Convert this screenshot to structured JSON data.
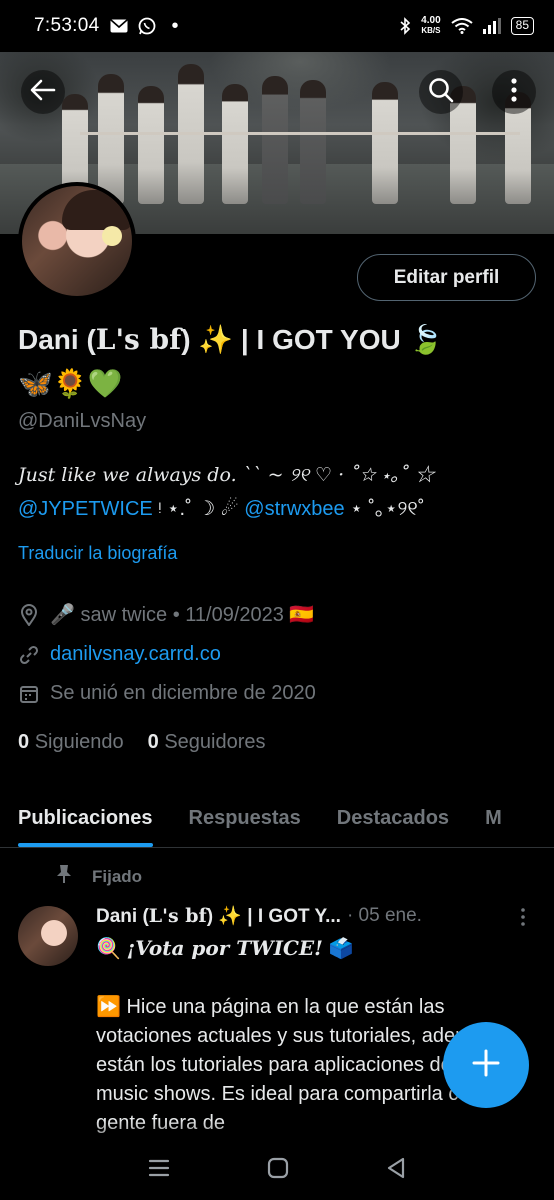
{
  "status_bar": {
    "time": "7:53:04",
    "speed_value": "4.00",
    "speed_unit": "KB/S",
    "battery": "85",
    "dot": "•"
  },
  "header": {
    "back_icon": "arrow-left-icon",
    "search_icon": "search-icon",
    "more_icon": "more-vertical-icon"
  },
  "profile": {
    "edit_button": "Editar perfil",
    "name_part1": "Dani (",
    "name_serif": "L's bf",
    "name_part2": ") ✨ | I GOT YOU 🍃",
    "name_line2": "🦋🌻💚",
    "handle": "@DaniLvsNay",
    "bio_line1": "Just like we always do. `` ~ ୨୧ ♡ · ˚☆ ⋆｡˚ ☆",
    "bio_mention1": "@JYPETWICE",
    "bio_mid": " ᵎ ⋆.˚ ☽ ☄ ",
    "bio_mention2": "@strwxbee",
    "bio_end": " ⋆ ˚｡⋆୨୧˚",
    "translate": "Traducir la biografía",
    "location": "🎤 saw twice • 11/09/2023 🇪🇸",
    "website": "danilvsnay.carrd.co",
    "joined": "Se unió en diciembre de 2020",
    "following_count": "0",
    "following_label": "Siguiendo",
    "followers_count": "0",
    "followers_label": "Seguidores"
  },
  "tabs": [
    {
      "label": "Publicaciones",
      "active": true
    },
    {
      "label": "Respuestas",
      "active": false
    },
    {
      "label": "Destacados",
      "active": false
    },
    {
      "label": "M",
      "active": false
    }
  ],
  "pinned_post": {
    "pinned_label": "Fijado",
    "author_part1": "Dani (",
    "author_serif": "L's bf",
    "author_part2": ") ✨ | I GOT Y...",
    "date": "· 05 ene.",
    "line1_emoji": "🍭 ",
    "line1_text": "¡Vota por TWICE!",
    "line1_end": " 🗳️",
    "body": "⏩ Hice una página en la que están las votaciones actuales y sus tutoriales, además están los tutoriales para aplicaciones de los music shows. Es ideal para compartirla con gente fuera de"
  },
  "colors": {
    "accent": "#1d9bf0",
    "text": "#e7e9ea",
    "muted": "#71767b",
    "background": "#000000"
  }
}
